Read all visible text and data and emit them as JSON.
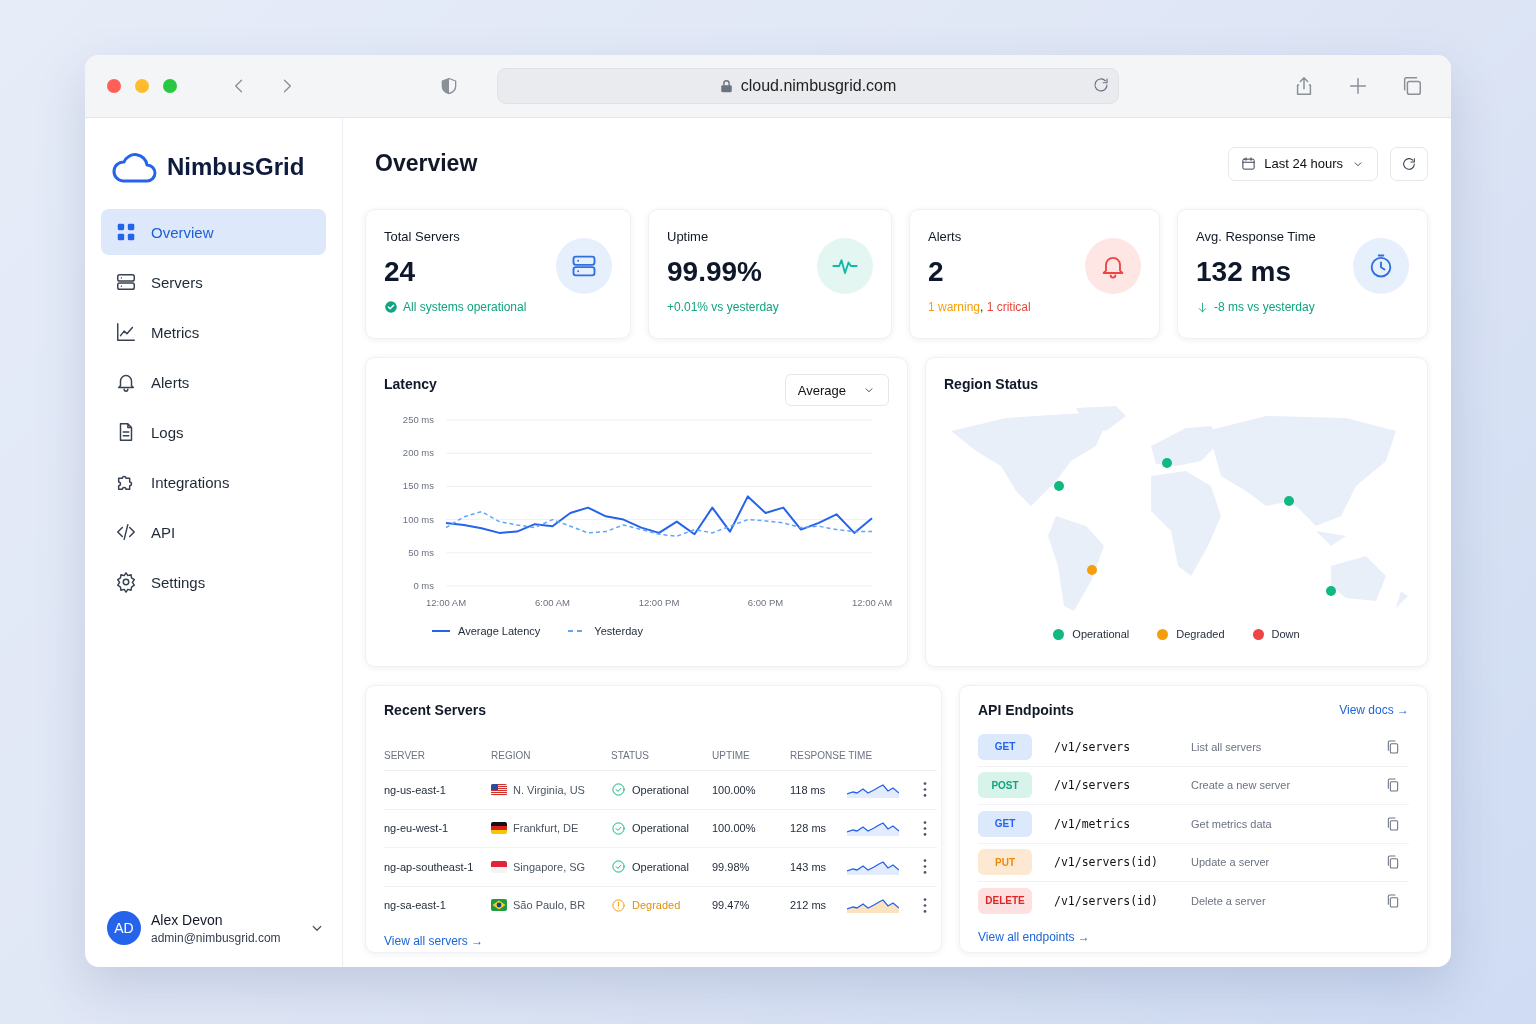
{
  "browser": {
    "url": "cloud.nimbusgrid.com"
  },
  "sidebar": {
    "brand": "NimbusGrid",
    "items": [
      {
        "label": "Overview",
        "selected": true
      },
      {
        "label": "Servers",
        "selected": false
      },
      {
        "label": "Metrics",
        "selected": false
      },
      {
        "label": "Alerts",
        "selected": false
      },
      {
        "label": "Logs",
        "selected": false
      },
      {
        "label": "Integrations",
        "selected": false
      },
      {
        "label": "API",
        "selected": false
      },
      {
        "label": "Settings",
        "selected": false
      }
    ],
    "user": {
      "initials": "AD",
      "name": "Alex Devon",
      "email": "admin@nimbusgrid.com"
    }
  },
  "header": {
    "title": "Overview",
    "range": "Last 24 hours"
  },
  "stats": [
    {
      "label": "Total Servers",
      "value": "24",
      "note": [
        {
          "text": "All systems operational",
          "color": "#10a37f"
        }
      ]
    },
    {
      "label": "Uptime",
      "value": "99.99%",
      "note": [
        {
          "text": "+0.01% vs yesterday",
          "color": "#10a37f"
        }
      ]
    },
    {
      "label": "Alerts",
      "value": "2",
      "note": [
        {
          "text": "1 warning",
          "color": "#f59e0b"
        },
        {
          "text": ", "
        },
        {
          "text": "1 critical",
          "color": "#e5483b"
        }
      ]
    },
    {
      "label": "Avg. Response Time",
      "value": "132 ms",
      "note": [
        {
          "text": "-8 ms vs yesterday",
          "color": "#10a37f"
        }
      ]
    }
  ],
  "latency": {
    "title": "Latency",
    "select": "Average",
    "chart_data": {
      "type": "line",
      "grid": true,
      "x": [
        0,
        1,
        2,
        3,
        4,
        5,
        6,
        7,
        8,
        9,
        10,
        11,
        12,
        13,
        14,
        15,
        16,
        17,
        18,
        19,
        20,
        21,
        22,
        23,
        24
      ],
      "ylim": [
        0,
        250
      ],
      "xlim": [
        0,
        24
      ],
      "yticks": [
        {
          "value": 0,
          "label": "0 ms"
        },
        {
          "value": 50,
          "label": "50 ms"
        },
        {
          "value": 100,
          "label": "100 ms"
        },
        {
          "value": 150,
          "label": "150 ms"
        },
        {
          "value": 200,
          "label": "200 ms"
        },
        {
          "value": 250,
          "label": "250 ms"
        }
      ],
      "xticks": [
        {
          "value": 0,
          "label": "12:00 AM"
        },
        {
          "value": 6,
          "label": "6:00 AM"
        },
        {
          "value": 12,
          "label": "12:00 PM"
        },
        {
          "value": 18,
          "label": "6:00 PM"
        },
        {
          "value": 24,
          "label": "12:00 AM"
        }
      ],
      "series": [
        {
          "name": "Average Latency",
          "color": "#2563eb",
          "line_style": "solid",
          "values": [
            95,
            92,
            87,
            80,
            82,
            93,
            90,
            110,
            118,
            105,
            100,
            88,
            80,
            97,
            78,
            118,
            82,
            135,
            110,
            118,
            85,
            95,
            108,
            80,
            102
          ]
        },
        {
          "name": "Yesterday",
          "color": "#60a5fa",
          "line_style": "dashed",
          "values": [
            88,
            104,
            112,
            97,
            92,
            88,
            100,
            90,
            80,
            82,
            92,
            85,
            78,
            75,
            85,
            80,
            90,
            100,
            98,
            95,
            88,
            90,
            85,
            82,
            82
          ]
        }
      ]
    }
  },
  "regions": {
    "title": "Region Status",
    "markers": [
      {
        "color": "#10b981"
      },
      {
        "color": "#10b981"
      },
      {
        "color": "#10b981"
      },
      {
        "color": "#f59e0b"
      },
      {
        "color": "#10b981"
      }
    ],
    "legend": [
      {
        "label": "Operational",
        "color": "#10b981"
      },
      {
        "label": "Degraded",
        "color": "#f59e0b"
      },
      {
        "label": "Down",
        "color": "#ef4444"
      }
    ]
  },
  "servers": {
    "title": "Recent Servers",
    "columns": [
      "SERVER",
      "REGION",
      "STATUS",
      "UPTIME",
      "RESPONSE TIME"
    ],
    "rows": [
      {
        "server": "ng-us-east-1",
        "region": "N. Virginia, US",
        "status": "Operational",
        "kind": "ok",
        "uptime": "100.00%",
        "response": "118 ms"
      },
      {
        "server": "ng-eu-west-1",
        "region": "Frankfurt, DE",
        "status": "Operational",
        "kind": "ok",
        "uptime": "100.00%",
        "response": "128 ms"
      },
      {
        "server": "ng-ap-southeast-1",
        "region": "Singapore, SG",
        "status": "Operational",
        "kind": "ok",
        "uptime": "99.98%",
        "response": "143 ms"
      },
      {
        "server": "ng-sa-east-1",
        "region": "São Paulo, BR",
        "status": "Degraded",
        "kind": "warn",
        "uptime": "99.47%",
        "response": "212 ms"
      }
    ],
    "link": "View all servers →"
  },
  "api": {
    "title": "API Endpoints",
    "docs_link": "View docs →",
    "endpoints": [
      {
        "method": "GET",
        "kind": "get",
        "path": "/v1/servers",
        "description": "List all servers"
      },
      {
        "method": "POST",
        "kind": "post",
        "path": "/v1/servers",
        "description": "Create a new server"
      },
      {
        "method": "GET",
        "kind": "get",
        "path": "/v1/metrics",
        "description": "Get metrics data"
      },
      {
        "method": "PUT",
        "kind": "put",
        "path": "/v1/servers(id)",
        "description": "Update a server"
      },
      {
        "method": "DELETE",
        "kind": "delete",
        "path": "/v1/servers(id)",
        "description": "Delete a server"
      }
    ],
    "link": "View all endpoints →"
  }
}
